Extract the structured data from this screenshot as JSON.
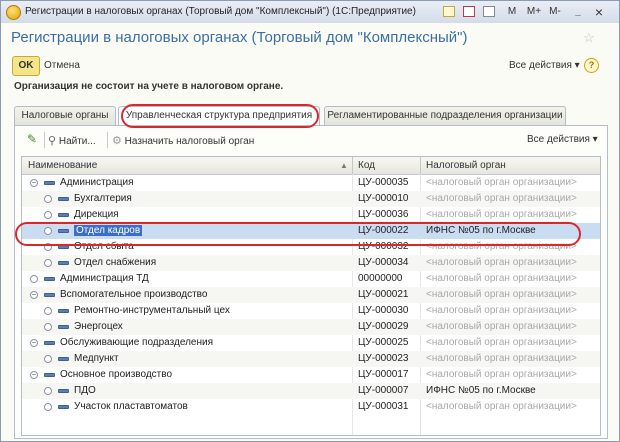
{
  "window": {
    "title": "Регистрации в налоговых органах (Торговый дом \"Комплексный\")  (1С:Предприятие)",
    "buttons": {
      "mem": "M",
      "mplus": "M+",
      "mminus": "M-",
      "minimize": "_",
      "close": "×"
    }
  },
  "header": {
    "title": "Регистрации в налоговых органах (Торговый дом \"Комплексный\")"
  },
  "commands": {
    "ok": "OK",
    "cancel": "Отмена",
    "all_actions": "Все действия ▾",
    "help": "?"
  },
  "info": {
    "text": "Организация не состоит на учете в налоговом органе."
  },
  "tabs": [
    {
      "label": "Налоговые органы",
      "active": false
    },
    {
      "label": "Управленческая структура предприятия",
      "active": true
    },
    {
      "label": "Регламентированные подразделения организации",
      "active": false
    }
  ],
  "toolbar": {
    "find": "Найти...",
    "assign": "Назначить налоговый орган",
    "all_actions": "Все действия ▾"
  },
  "grid": {
    "columns": [
      "Наименование",
      "Код",
      "Налоговый орган"
    ],
    "rows": [
      {
        "name": "Администрация",
        "code": "ЦУ-000035",
        "tax": "<налоговый орган организации>",
        "level": 0,
        "expander": "minus"
      },
      {
        "name": "Бухгалтерия",
        "code": "ЦУ-000010",
        "tax": "<налоговый орган организации>",
        "level": 1,
        "expander": "leaf"
      },
      {
        "name": "Дирекция",
        "code": "ЦУ-000036",
        "tax": "<налоговый орган организации>",
        "level": 1,
        "expander": "leaf"
      },
      {
        "name": "Отдел кадров",
        "code": "ЦУ-000022",
        "tax": "ИФНС №05 по г.Москве",
        "level": 1,
        "expander": "leaf",
        "selected": true
      },
      {
        "name": "Отдел сбыта",
        "code": "ЦУ-000032",
        "tax": "<налоговый орган организации>",
        "level": 1,
        "expander": "leaf"
      },
      {
        "name": "Отдел снабжения",
        "code": "ЦУ-000034",
        "tax": "<налоговый орган организации>",
        "level": 1,
        "expander": "leaf"
      },
      {
        "name": "Администрация ТД",
        "code": "00000000",
        "tax": "<налоговый орган организации>",
        "level": 0,
        "expander": "leaf"
      },
      {
        "name": "Вспомогательное производство",
        "code": "ЦУ-000021",
        "tax": "<налоговый орган организации>",
        "level": 0,
        "expander": "minus"
      },
      {
        "name": "Ремонтно-инструментальный цех",
        "code": "ЦУ-000030",
        "tax": "<налоговый орган организации>",
        "level": 1,
        "expander": "leaf"
      },
      {
        "name": "Энергоцех",
        "code": "ЦУ-000029",
        "tax": "<налоговый орган организации>",
        "level": 1,
        "expander": "leaf"
      },
      {
        "name": "Обслуживающие подразделения",
        "code": "ЦУ-000025",
        "tax": "<налоговый орган организации>",
        "level": 0,
        "expander": "minus"
      },
      {
        "name": "Медпункт",
        "code": "ЦУ-000023",
        "tax": "<налоговый орган организации>",
        "level": 1,
        "expander": "leaf"
      },
      {
        "name": "Основное производство",
        "code": "ЦУ-000017",
        "tax": "<налоговый орган организации>",
        "level": 0,
        "expander": "minus"
      },
      {
        "name": "ПДО",
        "code": "ЦУ-000007",
        "tax": "ИФНС №05 по г.Москве",
        "level": 1,
        "expander": "leaf"
      },
      {
        "name": "Участок пластавтоматов",
        "code": "ЦУ-000031",
        "tax": "<налоговый орган организации>",
        "level": 1,
        "expander": "leaf"
      }
    ]
  }
}
